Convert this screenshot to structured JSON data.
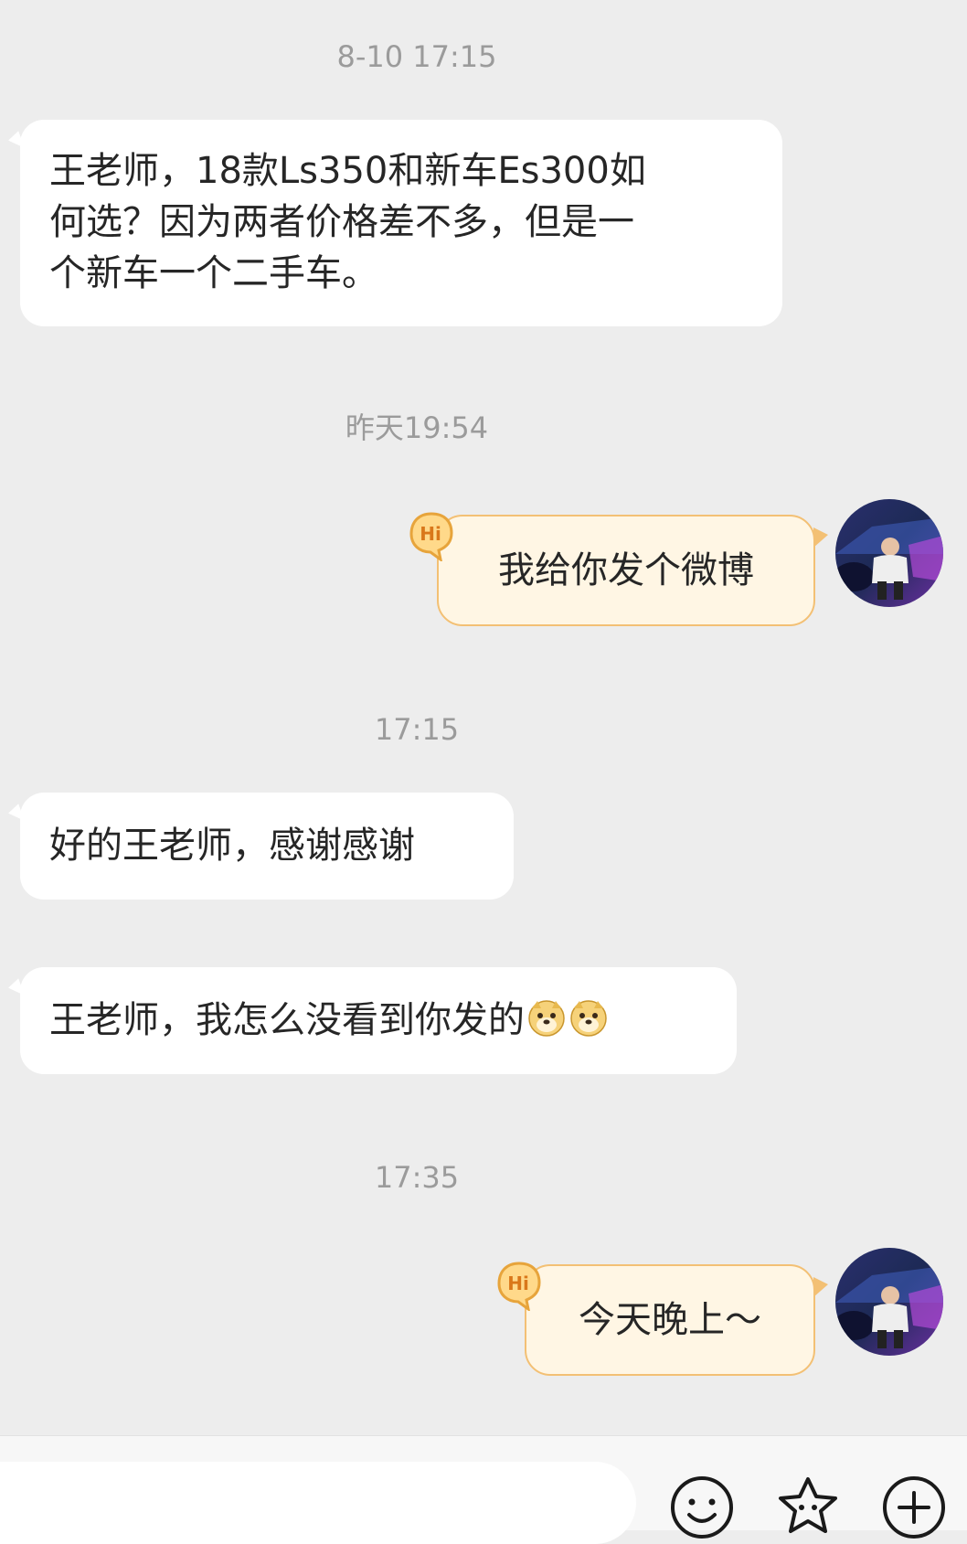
{
  "timestamps": {
    "t1": "8-10 17:15",
    "t2": "昨天19:54",
    "t3": "17:15",
    "t4": "17:35"
  },
  "messages": {
    "in1_line1": "王老师，18款Ls350和新车Es300如",
    "in1_line2": "何选？因为两者价格差不多，但是一",
    "in1_line3": "个新车一个二手车。",
    "out1": "我给你发个微博",
    "in2": "好的王老师，感谢感谢",
    "in3": "王老师，我怎么没看到你发的",
    "out2": "今天晚上～"
  },
  "badges": {
    "hi": "Hi"
  },
  "icons": {
    "emoji_button": "smiley-face-icon",
    "sticker_button": "star-face-icon",
    "more_button": "plus-circle-icon",
    "inline_emoji": "doge-emoji-icon"
  },
  "input": {
    "placeholder": ""
  },
  "colors": {
    "background": "#ededed",
    "incoming_bubble": "#ffffff",
    "outgoing_bubble": "#fff6e4",
    "outgoing_border": "#f3c074",
    "badge": "#f7b84a"
  }
}
